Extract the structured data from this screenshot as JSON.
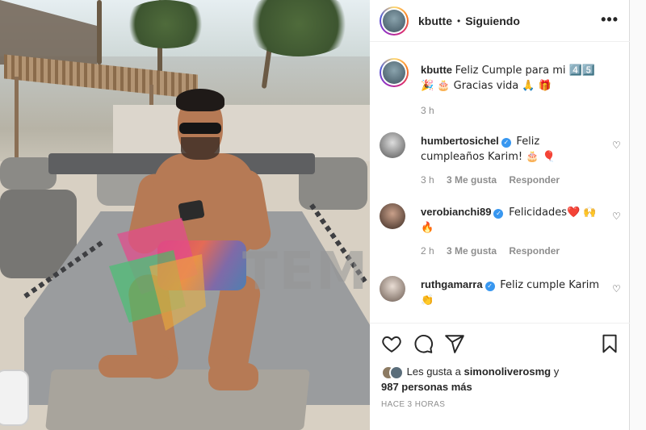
{
  "watermark": {
    "text": "TEMPOX"
  },
  "post": {
    "username": "kbutte",
    "separator": "•",
    "follow_status": "Siguiendo",
    "more_glyph": "•••"
  },
  "caption": {
    "username": "kbutte",
    "text": "Feliz Cumple para mi 4️⃣5️⃣🎉 🎂 Gracias vida 🙏 🎁",
    "time": "3 h"
  },
  "comments": [
    {
      "username": "humbertosichel",
      "verified": true,
      "text": "Feliz cumpleaños Karim! 🎂 🎈",
      "time": "3 h",
      "likes": "3 Me gusta",
      "reply": "Responder"
    },
    {
      "username": "verobianchi89",
      "verified": true,
      "text": "Felicidades❤️ 🙌 🔥",
      "time": "2 h",
      "likes": "3 Me gusta",
      "reply": "Responder"
    },
    {
      "username": "ruthgamarra",
      "verified": true,
      "text": "Feliz cumple Karim 👏",
      "time": "",
      "likes": "",
      "reply": ""
    }
  ],
  "likes": {
    "prefix": "Les gusta a",
    "user": "simonoliverosmg",
    "connector": "y",
    "others": "987 personas más"
  },
  "posted": "HACE 3 HORAS",
  "icons": {
    "like": "heart-icon",
    "comment": "comment-icon",
    "share": "share-icon",
    "save": "bookmark-icon"
  }
}
